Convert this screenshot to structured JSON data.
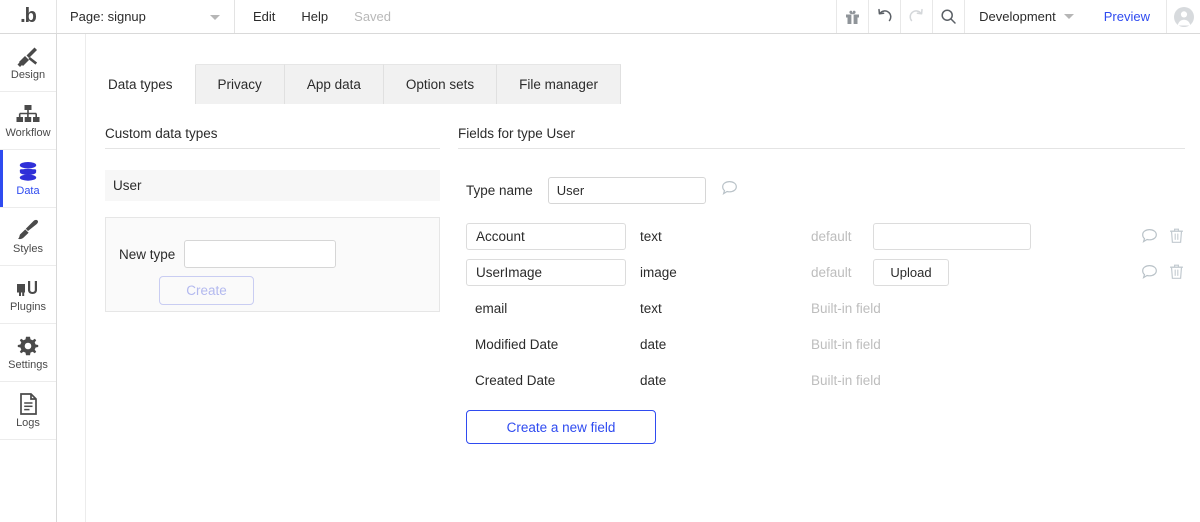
{
  "topbar": {
    "logo": ".b",
    "page_label": "Page: signup",
    "menu": [
      {
        "label": "Edit",
        "muted": false
      },
      {
        "label": "Help",
        "muted": false
      },
      {
        "label": "Saved",
        "muted": true
      }
    ],
    "icons": {
      "gift": "gift-icon",
      "undo": "undo-icon",
      "redo": "redo-icon",
      "search": "search-icon",
      "avatar": "avatar-icon"
    },
    "environment": "Development",
    "preview_label": "Preview",
    "accent_color": "#2f4bf0"
  },
  "sidebar": {
    "items": [
      {
        "label": "Design",
        "icon": "design-icon",
        "active": false
      },
      {
        "label": "Workflow",
        "icon": "workflow-icon",
        "active": false
      },
      {
        "label": "Data",
        "icon": "database-icon",
        "active": true
      },
      {
        "label": "Styles",
        "icon": "brush-icon",
        "active": false
      },
      {
        "label": "Plugins",
        "icon": "plugins-icon",
        "active": false
      },
      {
        "label": "Settings",
        "icon": "gear-icon",
        "active": false
      },
      {
        "label": "Logs",
        "icon": "document-icon",
        "active": false
      }
    ]
  },
  "tabs": [
    {
      "label": "Data types",
      "active": true
    },
    {
      "label": "Privacy",
      "active": false
    },
    {
      "label": "App data",
      "active": false
    },
    {
      "label": "Option sets",
      "active": false
    },
    {
      "label": "File manager",
      "active": false
    }
  ],
  "left_panel": {
    "title": "Custom data types",
    "data_types": [
      {
        "name": "User",
        "selected": true
      }
    ],
    "new_type": {
      "label": "New type",
      "value": "",
      "placeholder": "",
      "create_button": "Create",
      "create_disabled": true
    }
  },
  "right_panel": {
    "title": "Fields for type User",
    "type_name": {
      "label": "Type name",
      "value": "User",
      "comment_icon": "comment-icon"
    },
    "fields": [
      {
        "name": "Account",
        "editable": true,
        "type": "text",
        "default_label": "default",
        "default_kind": "input",
        "default_value": "",
        "builtin": false,
        "comment_icon": "comment-icon",
        "delete_icon": "trash-icon"
      },
      {
        "name": "UserImage",
        "editable": true,
        "type": "image",
        "default_label": "default",
        "default_kind": "upload",
        "upload_label": "Upload",
        "builtin": false,
        "comment_icon": "comment-icon",
        "delete_icon": "trash-icon"
      },
      {
        "name": "email",
        "editable": false,
        "type": "text",
        "builtin": true,
        "builtin_label": "Built-in field"
      },
      {
        "name": "Modified Date",
        "editable": false,
        "type": "date",
        "builtin": true,
        "builtin_label": "Built-in field"
      },
      {
        "name": "Created Date",
        "editable": false,
        "type": "date",
        "builtin": true,
        "builtin_label": "Built-in field"
      }
    ],
    "create_field_button": "Create a new field"
  }
}
